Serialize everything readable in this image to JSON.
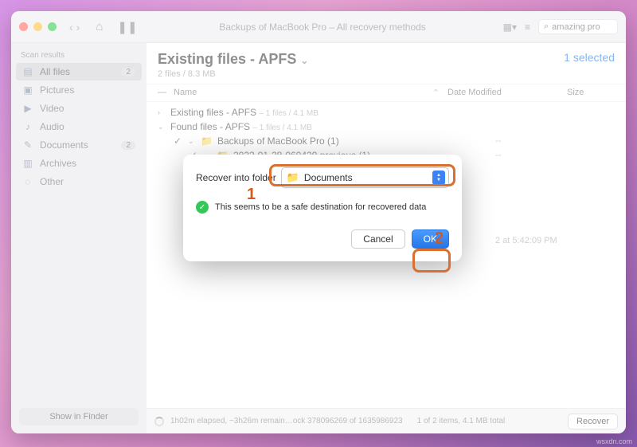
{
  "titlebar": {
    "title": "Backups of MacBook Pro – All recovery methods",
    "search_value": "amazing pro"
  },
  "sidebar": {
    "header": "Scan results",
    "items": [
      {
        "label": "All files",
        "badge": "2"
      },
      {
        "label": "Pictures"
      },
      {
        "label": "Video"
      },
      {
        "label": "Audio"
      },
      {
        "label": "Documents",
        "badge": "2"
      },
      {
        "label": "Archives"
      },
      {
        "label": "Other"
      }
    ],
    "footer": "Show in Finder"
  },
  "main": {
    "title": "Existing files - APFS",
    "subtitle": "2 files / 8.3 MB",
    "selected": "1 selected",
    "cols": {
      "name": "Name",
      "date": "Date Modified",
      "size": "Size"
    },
    "groups": [
      {
        "label": "Existing files - APFS",
        "meta": "– 1 files / 4.1 MB",
        "expanded": false
      },
      {
        "label": "Found files - APFS",
        "meta": "– 1 files / 4.1 MB",
        "expanded": true
      }
    ],
    "tree": {
      "n1": "Backups of MacBook Pro (1)",
      "n1_date": "--",
      "n2": "2022-01-28-060429.previous (1)",
      "n2_date": "--",
      "n3_date_frag": "2 at 5:42:09 PM"
    }
  },
  "statusbar": {
    "text": "1h02m elapsed, ~3h26m remain…ock 378096269 of 1635986923",
    "count": "1 of 2 items, 4.1 MB total",
    "recover": "Recover"
  },
  "dialog": {
    "label": "Recover into folder",
    "folder": "Documents",
    "msg": "This seems to be a safe destination for recovered data",
    "cancel": "Cancel",
    "ok": "OK"
  },
  "annotations": {
    "a1": "1",
    "a2": "2"
  },
  "watermark": "wsxdn.com"
}
